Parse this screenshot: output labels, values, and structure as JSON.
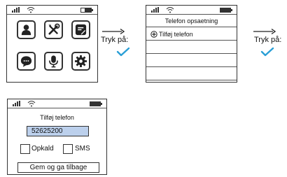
{
  "screens": {
    "home": {
      "apps": [
        {
          "icon": "person-icon"
        },
        {
          "icon": "tools-icon"
        },
        {
          "icon": "edit-message-icon"
        },
        {
          "icon": "chat-bubble-icon"
        },
        {
          "icon": "microphone-icon"
        },
        {
          "icon": "gear-icon"
        }
      ]
    },
    "settings": {
      "title": "Telefon opsaetning",
      "add_item": "Tilføj telefon",
      "add_icon": "plus-circle-icon"
    },
    "add_phone": {
      "title": "Tilføj telefon",
      "phone_number": "52625200",
      "call_label": "Opkald",
      "call_checked": false,
      "sms_label": "SMS",
      "sms_checked": false,
      "save_label": "Gem og ga tilbage"
    }
  },
  "steps": [
    {
      "label": "Tryk på:",
      "icon": "checkmark-icon"
    },
    {
      "label": "Tryk på:",
      "icon": "checkmark-icon"
    }
  ],
  "colors": {
    "check": "#2a9fd6",
    "input_bg": "#bcd0ec",
    "outline": "#333333"
  }
}
